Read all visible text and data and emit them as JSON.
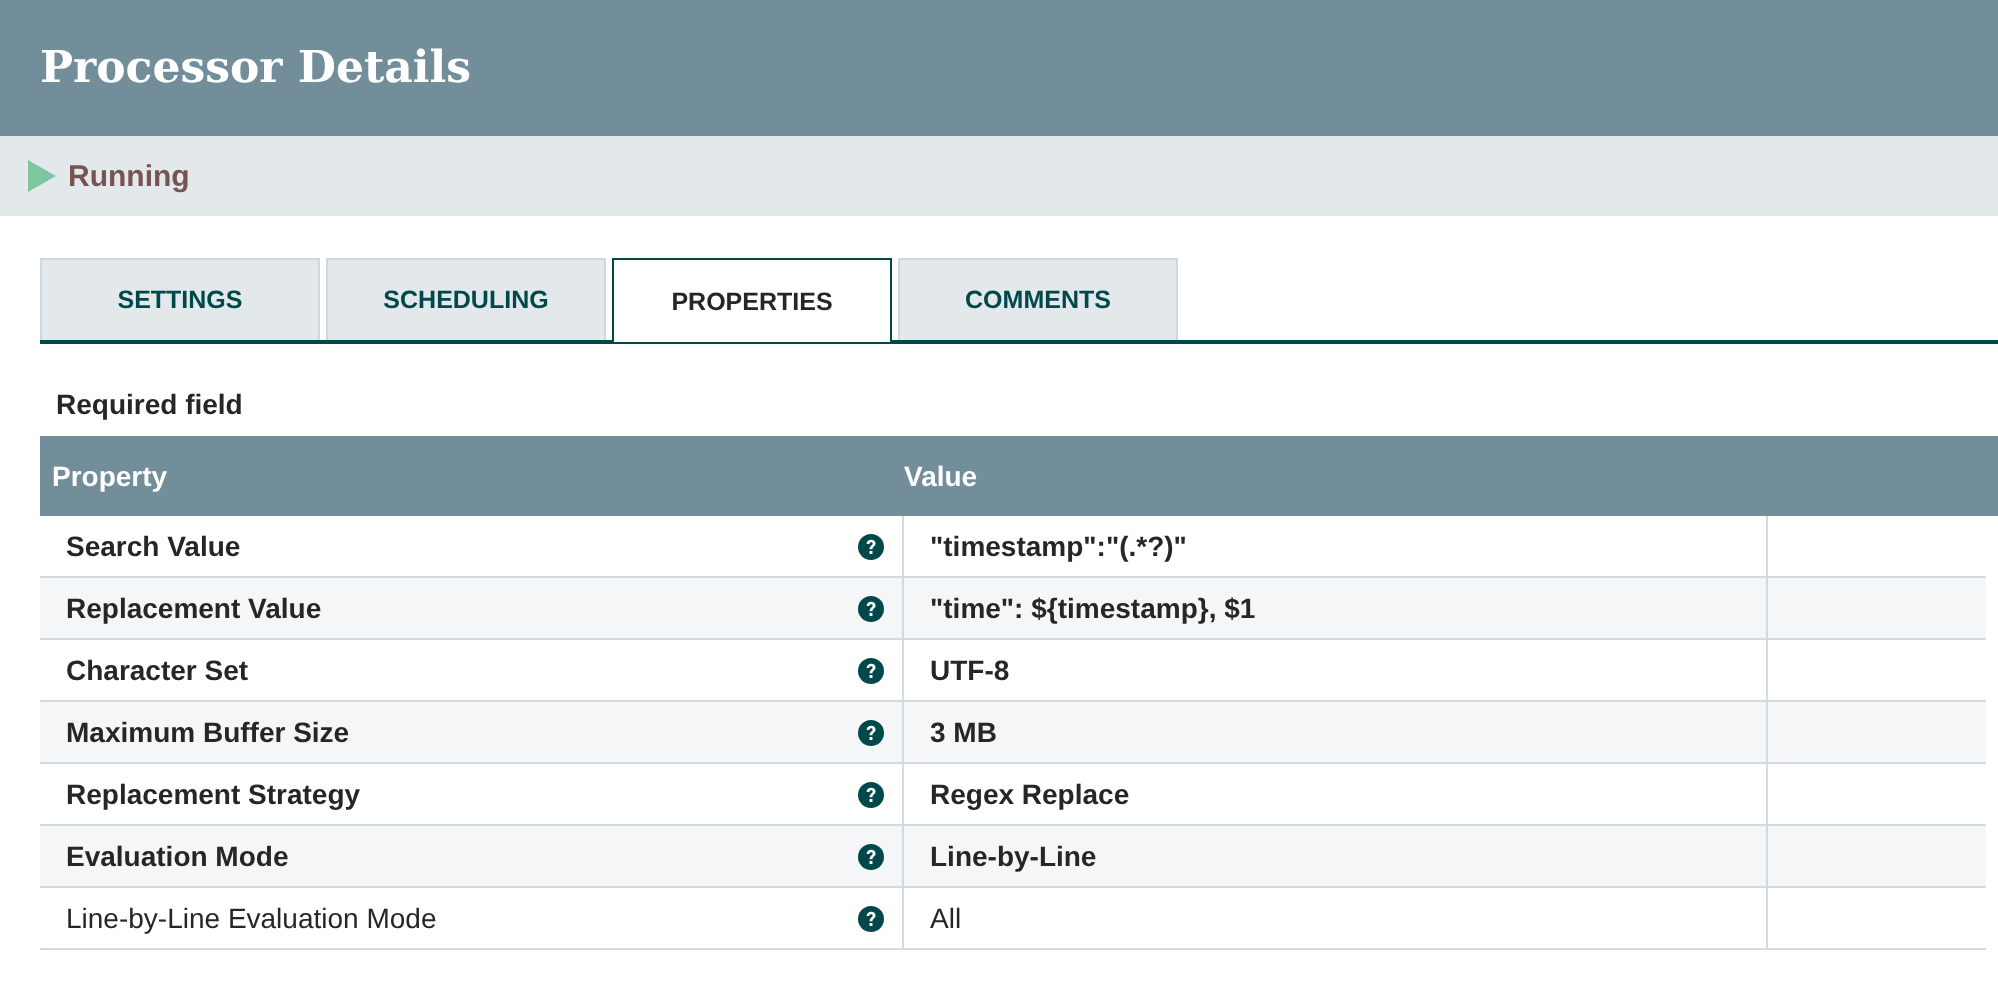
{
  "title": "Processor Details",
  "status": {
    "label": "Running",
    "kind": "running"
  },
  "tabs": [
    {
      "label": "SETTINGS",
      "selected": false
    },
    {
      "label": "SCHEDULING",
      "selected": false
    },
    {
      "label": "PROPERTIES",
      "selected": true
    },
    {
      "label": "COMMENTS",
      "selected": false
    }
  ],
  "legend": "Required field",
  "table": {
    "columns": [
      "Property",
      "Value"
    ],
    "rows": [
      {
        "property": "Search Value",
        "value": "\"timestamp\":\"(.*?)\"",
        "required": true
      },
      {
        "property": "Replacement Value",
        "value": "\"time\": ${timestamp}, $1",
        "required": true
      },
      {
        "property": "Character Set",
        "value": "UTF-8",
        "required": true
      },
      {
        "property": "Maximum Buffer Size",
        "value": "3 MB",
        "required": true
      },
      {
        "property": "Replacement Strategy",
        "value": "Regex Replace",
        "required": true
      },
      {
        "property": "Evaluation Mode",
        "value": "Line-by-Line",
        "required": true
      },
      {
        "property": "Line-by-Line Evaluation Mode",
        "value": "All",
        "required": false
      }
    ]
  }
}
